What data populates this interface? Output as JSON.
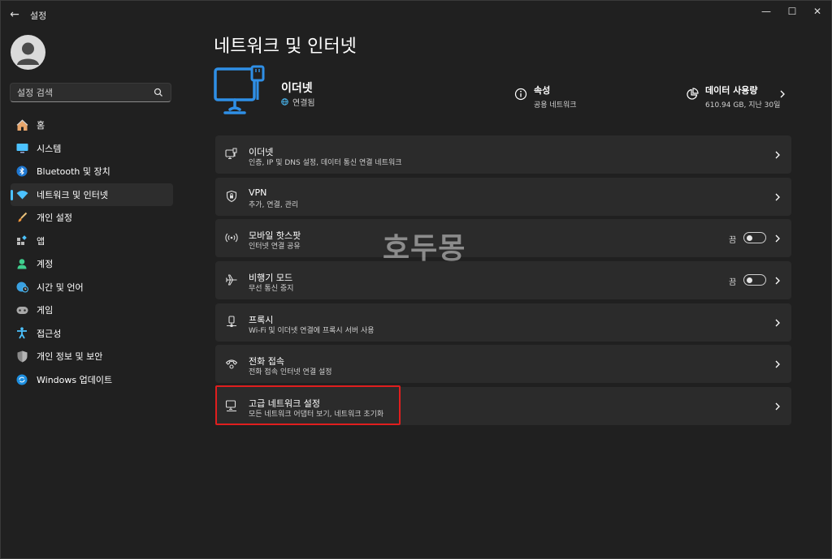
{
  "titlebar": {
    "app_title": "설정",
    "back": "←",
    "minimize": "—",
    "maximize": "☐",
    "close": "✕"
  },
  "search": {
    "placeholder": "설정 검색"
  },
  "sidebar": {
    "items": [
      {
        "label": "홈",
        "icon": "home-icon"
      },
      {
        "label": "시스템",
        "icon": "monitor-icon"
      },
      {
        "label": "Bluetooth 및 장치",
        "icon": "bluetooth-icon"
      },
      {
        "label": "네트워크 및 인터넷",
        "icon": "wifi-icon",
        "active": true
      },
      {
        "label": "개인 설정",
        "icon": "brush-icon"
      },
      {
        "label": "앱",
        "icon": "apps-icon"
      },
      {
        "label": "계정",
        "icon": "person-icon"
      },
      {
        "label": "시간 및 언어",
        "icon": "globe-clock-icon"
      },
      {
        "label": "게임",
        "icon": "gamepad-icon"
      },
      {
        "label": "접근성",
        "icon": "accessibility-icon"
      },
      {
        "label": "개인 정보 및 보안",
        "icon": "shield-icon"
      },
      {
        "label": "Windows 업데이트",
        "icon": "update-icon"
      }
    ]
  },
  "main": {
    "title": "네트워크 및 인터넷",
    "ethernet": {
      "name": "이더넷",
      "status": "연결됨"
    },
    "properties": {
      "title": "속성",
      "subtitle": "공용 네트워크"
    },
    "data_usage": {
      "title": "데이터 사용량",
      "subtitle": "610.94 GB, 지난 30일"
    },
    "cards": [
      {
        "title": "이더넷",
        "subtitle": "인증, IP 및 DNS 설정, 데이터 통신 연결 네트워크",
        "icon": "ethernet-icon"
      },
      {
        "title": "VPN",
        "subtitle": "추가, 연결, 관리",
        "icon": "vpn-shield-icon"
      },
      {
        "title": "모바일 핫스팟",
        "subtitle": "인터넷 연결 공유",
        "icon": "hotspot-icon",
        "toggle": "끔"
      },
      {
        "title": "비행기 모드",
        "subtitle": "무선 통신 중지",
        "icon": "airplane-icon",
        "toggle": "끔"
      },
      {
        "title": "프록시",
        "subtitle": "Wi-Fi 및 이더넷 연결에 프록시 서버 사용",
        "icon": "proxy-icon"
      },
      {
        "title": "전화 접속",
        "subtitle": "전화 접속 인터넷 연결 설정",
        "icon": "dialup-icon"
      },
      {
        "title": "고급 네트워크 설정",
        "subtitle": "모든 네트워크 어댑터 보기, 네트워크 초기화",
        "icon": "advanced-network-icon"
      }
    ]
  },
  "watermark": "호두몽",
  "colors": {
    "accent": "#4cc2ff",
    "highlight": "#e01e1e",
    "background": "#202020",
    "card": "#2b2b2b"
  }
}
